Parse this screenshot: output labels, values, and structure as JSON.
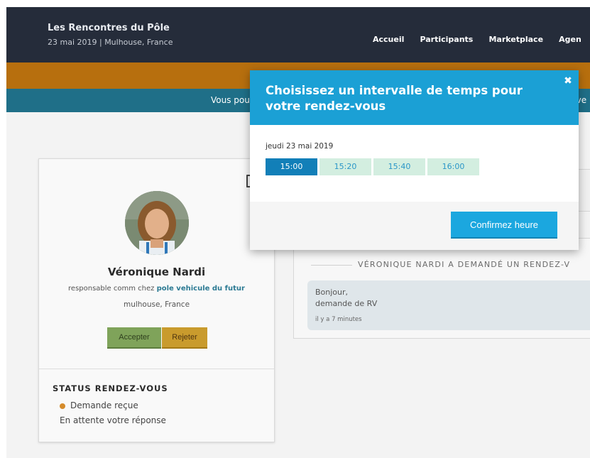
{
  "header": {
    "title": "Les Rencontres du Pôle",
    "subtitle": "23 mai 2019 | Mulhouse, France",
    "nav": [
      "Accueil",
      "Participants",
      "Marketplace",
      "Agen"
    ]
  },
  "info_bar": {
    "left_text": "Vous pou",
    "right_text": "uve"
  },
  "profile": {
    "name": "Véronique Nardi",
    "role_prefix": "responsable comm chez ",
    "organization": "pole vehicule du futur",
    "location": "mulhouse, France",
    "accept_label": "Accepter",
    "reject_label": "Rejeter",
    "status_title": "STATUS RENDEZ-VOUS",
    "status_line1": "Demande reçue",
    "status_line2": "En attente votre réponse"
  },
  "conversation": {
    "heading": "VÉRONIQUE NARDI A DEMANDÉ UN RENDEZ-V",
    "message_line1": "Bonjour,",
    "message_line2": "demande de RV",
    "time": "il y a 7 minutes"
  },
  "modal": {
    "title": "Choisissez un intervalle de temps pour votre rendez-vous",
    "close_symbol": "✖",
    "date": "jeudi 23 mai 2019",
    "slots": [
      {
        "label": "15:00",
        "selected": true
      },
      {
        "label": "15:20",
        "selected": false
      },
      {
        "label": "15:40",
        "selected": false
      },
      {
        "label": "16:00",
        "selected": false
      }
    ],
    "confirm_label": "Confirmez heure"
  },
  "colors": {
    "header_bg": "#252c3a",
    "orange_bar": "#b76f0e",
    "info_bar": "#1f6f88",
    "modal_accent": "#1ba0d5",
    "slot_selected": "#127fb8",
    "slot_available": "#d3eee0"
  }
}
